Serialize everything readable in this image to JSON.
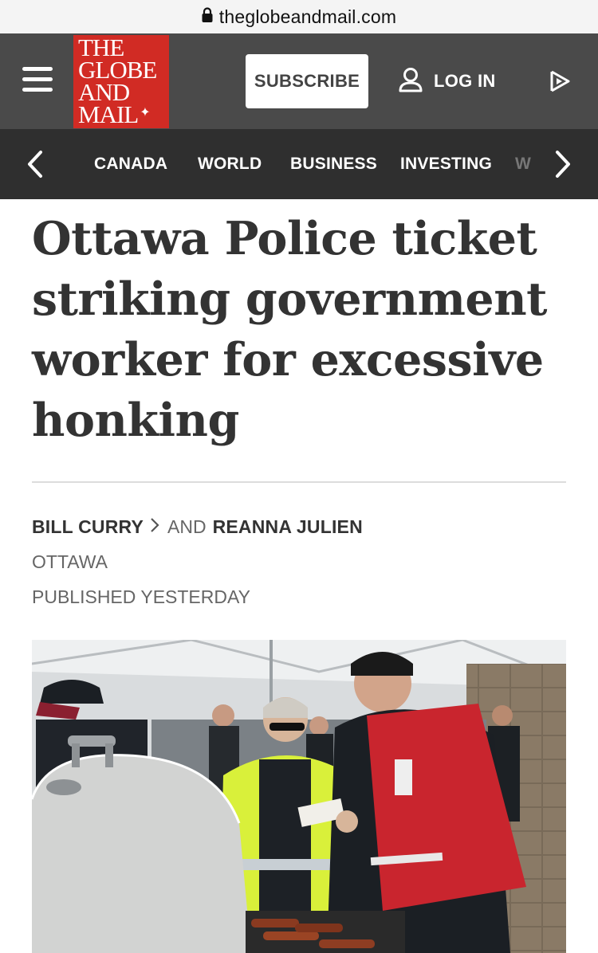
{
  "browser": {
    "url": "theglobeandmail.com",
    "lock_icon": "lock-icon"
  },
  "masthead": {
    "logo_lines": [
      "THE",
      "GLOBE",
      "AND",
      "MAIL"
    ],
    "logo_color": "#d12b24",
    "background_color": "#4a4a4a",
    "subscribe_label": "SUBSCRIBE",
    "login_label": "LOG IN",
    "menu_icon": "hamburger-menu-icon",
    "user_icon": "user-icon",
    "play_icon": "play-icon"
  },
  "section_nav": {
    "items": [
      "CANADA",
      "WORLD",
      "BUSINESS",
      "INVESTING"
    ],
    "background_color": "#2f2f2f",
    "left_icon": "chevron-left-icon",
    "right_icon": "chevron-right-icon"
  },
  "article": {
    "headline": "Ottawa Police ticket striking government worker for excessive honking",
    "authors": [
      "BILL CURRY",
      "REANNA JULIEN"
    ],
    "author_joiner": "AND",
    "dateline": "OTTAWA",
    "published": "PUBLISHED YESTERDAY"
  }
}
